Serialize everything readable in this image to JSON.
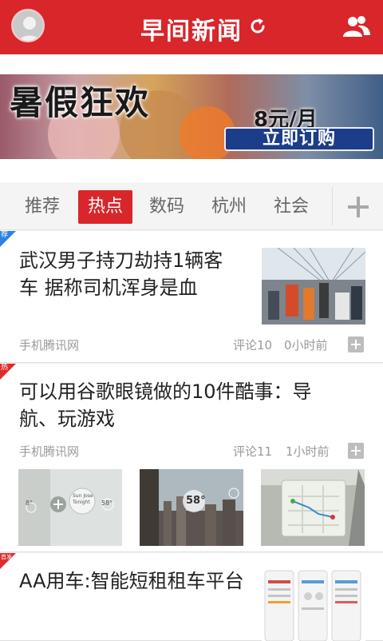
{
  "header": {
    "title": "早间新闻",
    "avatar_icon": "user-avatar-icon",
    "refresh_icon": "refresh-icon",
    "friends_icon": "friends-icon",
    "accent": "#d8262b"
  },
  "banner": {
    "title": "暑假狂欢",
    "price": "8元/月",
    "button": "立即订购"
  },
  "tabs": [
    {
      "label": "推荐",
      "active": false
    },
    {
      "label": "热点",
      "active": true
    },
    {
      "label": "数码",
      "active": false
    },
    {
      "label": "杭州",
      "active": false
    },
    {
      "label": "社会",
      "active": false
    }
  ],
  "add_tab_icon": "plus-icon",
  "news": [
    {
      "tag": "荐",
      "title_lines": [
        "武汉男子持刀劫持1辆客",
        "车 据称司机浑身是血"
      ],
      "source": "手机腾讯网",
      "comments": "评论10",
      "time": "0小时前"
    },
    {
      "tag": "热",
      "title_lines": [
        "可以用谷歌眼镜做的10件酷事：导",
        "航、玩游戏"
      ],
      "source": "手机腾讯网",
      "comments": "评论11",
      "time": "1小时前",
      "images": [
        {
          "readout_left": "8°",
          "readout_center": "Sun Jose",
          "readout_center2": "Tonight",
          "readout_right": "58°"
        },
        {
          "readout": "58°"
        },
        {
          "label": "map"
        }
      ]
    },
    {
      "tag": "首发",
      "title_lines": [
        "AA用车:智能短租租车平台"
      ]
    }
  ]
}
